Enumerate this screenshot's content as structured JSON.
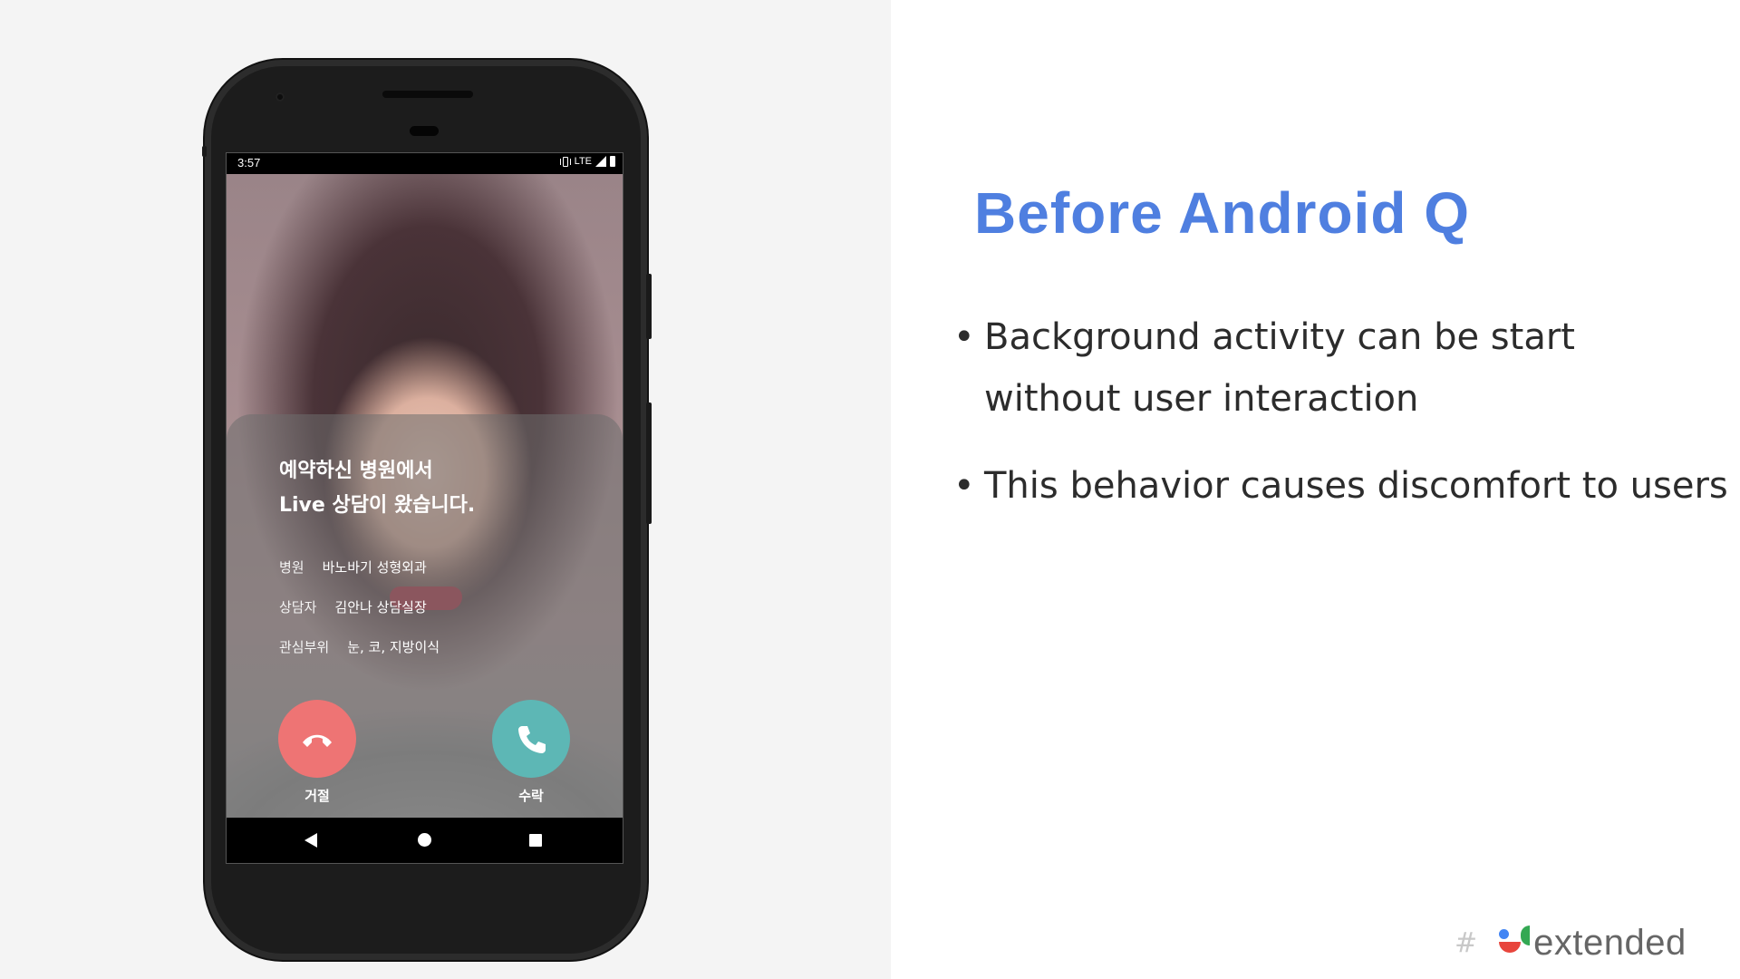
{
  "slide": {
    "title": "Before Android Q",
    "bullets": [
      {
        "text": "Background activity can be start\nwithout user interaction"
      },
      {
        "text": "This behavior causes discomfort to users"
      }
    ],
    "logo_text": "extended",
    "logo_hash": "#",
    "bullet_glyph": "•"
  },
  "phone": {
    "status_bar": {
      "time": "3:57",
      "network": "LTE"
    },
    "call": {
      "title_line1": "예약하신 병원에서",
      "title_line2": "Live 상담이 왔습니다.",
      "rows": [
        {
          "label": "병원",
          "value": "바노바기 성형외과"
        },
        {
          "label": "상담자",
          "value": "김안나 상담실장"
        },
        {
          "label": "관심부위",
          "value": "눈, 코, 지방이식"
        }
      ],
      "decline_label": "거절",
      "accept_label": "수락"
    }
  },
  "colors": {
    "title": "#4f7fe0",
    "decline": "#ee7474",
    "accept": "#5db7b5",
    "left_bg": "#f4f4f4"
  }
}
